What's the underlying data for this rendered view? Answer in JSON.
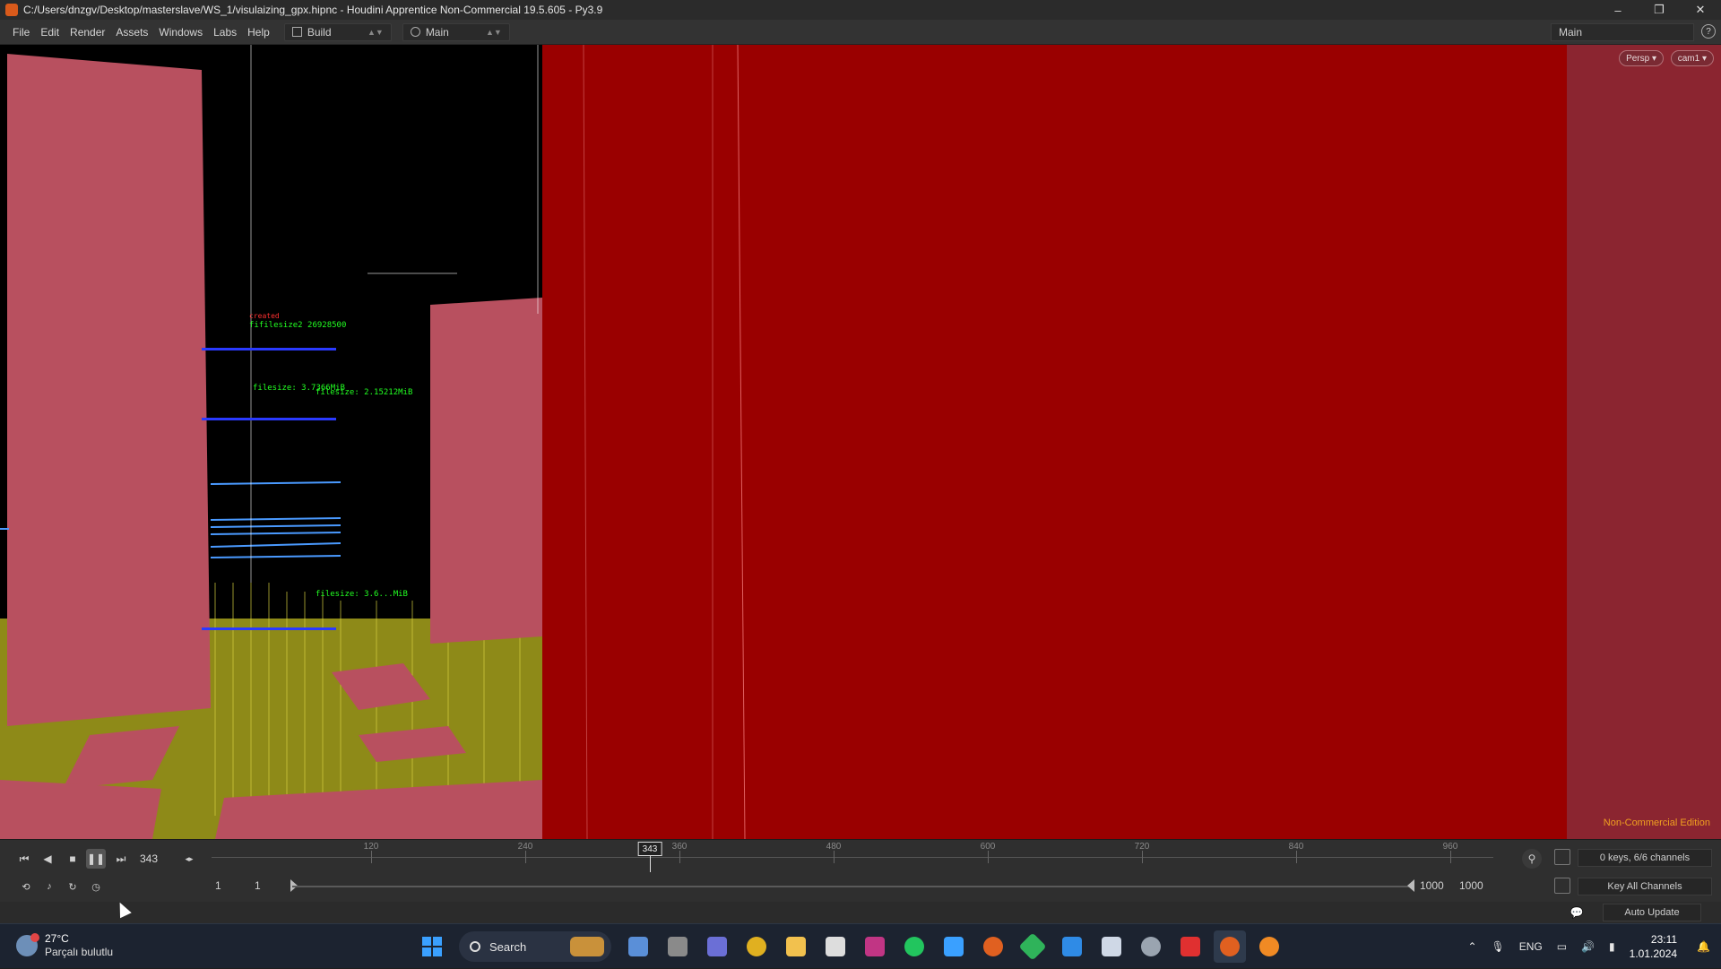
{
  "window": {
    "title": "C:/Users/dnzgv/Desktop/masterslave/WS_1/visulaizing_gpx.hipnc - Houdini Apprentice Non-Commercial 19.5.605 - Py3.9",
    "controls": [
      "–",
      "❐",
      "✕"
    ]
  },
  "menu": {
    "items": [
      "File",
      "Edit",
      "Render",
      "Assets",
      "Windows",
      "Labs",
      "Help"
    ],
    "build_desktop": "Build",
    "main_desktop": "Main",
    "right_desktop": "Main",
    "help_glyph": "?"
  },
  "viewport": {
    "persp": "Persp ▾",
    "camera": "cam1 ▾",
    "watermark": "Non-Commercial Edition",
    "annotations": [
      {
        "text": "fifilesize2 26928500",
        "color": "#22ff22"
      },
      {
        "text": "filesize: 3.7366MiB",
        "color": "#22ff22"
      },
      {
        "text": "filesize: 2.15212MiB",
        "color": "#22ff22"
      },
      {
        "text": "filesize: 3.6...MiB",
        "color": "#22ff22"
      }
    ],
    "colors": {
      "red_panel": "#9a0000",
      "pink_geo": "#b8505f",
      "grass": "#a8a020"
    }
  },
  "timeline": {
    "current_frame": "343",
    "ruler_labels": [
      "120",
      "240",
      "360",
      "480",
      "600",
      "720",
      "840",
      "960"
    ],
    "range_start": "1",
    "range_start2": "1",
    "range_end": "1000",
    "range_end2": "1000",
    "keys_info": "0 keys, 6/6 channels",
    "key_all": "Key All Channels",
    "auto_update": "Auto Update"
  },
  "taskbar": {
    "temperature": "27°C",
    "weather": "Parçalı bulutlu",
    "search": "Search",
    "lang": "ENG",
    "time": "23:11",
    "date": "1.01.2024",
    "apps": [
      {
        "name": "widgets",
        "color": "#5a8fd8"
      },
      {
        "name": "file-explorer-dark",
        "color": "#8a8a8a"
      },
      {
        "name": "teams",
        "color": "#6b6fd6"
      },
      {
        "name": "chrome",
        "color": "#e0b020"
      },
      {
        "name": "folder",
        "color": "#f2c14e"
      },
      {
        "name": "inkscape",
        "color": "#dddddd"
      },
      {
        "name": "instagram",
        "color": "#c13584"
      },
      {
        "name": "xbox",
        "color": "#22c55e"
      },
      {
        "name": "notepad",
        "color": "#3aa0ff"
      },
      {
        "name": "houdini-launcher",
        "color": "#e06020"
      },
      {
        "name": "git",
        "color": "#2fb35a"
      },
      {
        "name": "vscode",
        "color": "#2f8be6"
      },
      {
        "name": "xampp",
        "color": "#cfd8e6"
      },
      {
        "name": "settings",
        "color": "#9aa4b0"
      },
      {
        "name": "acrobat",
        "color": "#e03030"
      },
      {
        "name": "houdini",
        "color": "#e06020"
      },
      {
        "name": "blender",
        "color": "#f08a24"
      }
    ]
  }
}
